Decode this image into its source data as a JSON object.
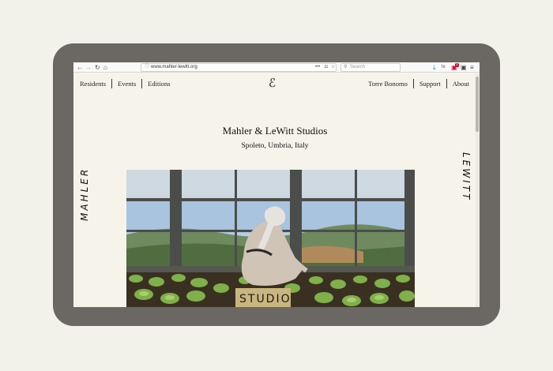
{
  "browser": {
    "url": "www.mahler-lewitt.org",
    "search_placeholder": "Search",
    "icons": {
      "back": "←",
      "forward": "→",
      "reload": "↻",
      "home": "⌂",
      "info": "ⓘ",
      "more": "•••",
      "pocket": "◘",
      "bookmark": "☆",
      "search": "⚲",
      "download": "⤓",
      "library": "lıı",
      "sync": "▣",
      "menu": "≡"
    },
    "badge_count": "1"
  },
  "site": {
    "nav_left": [
      "Residents",
      "Events",
      "Editions"
    ],
    "nav_right": [
      "Torre Bonomo",
      "Support",
      "About"
    ],
    "logo_glyph": "ℰ",
    "title": "Mahler & LeWitt Studios",
    "subtitle": "Spoleto, Umbria, Italy",
    "side_left": "MAHLER",
    "side_right": "LEWITT",
    "photo_sign": "STUDIO"
  },
  "colors": {
    "page_bg": "#f3f2ea",
    "device_frame": "#6b6762",
    "site_bg": "#f6f4ea",
    "text": "#111111"
  }
}
